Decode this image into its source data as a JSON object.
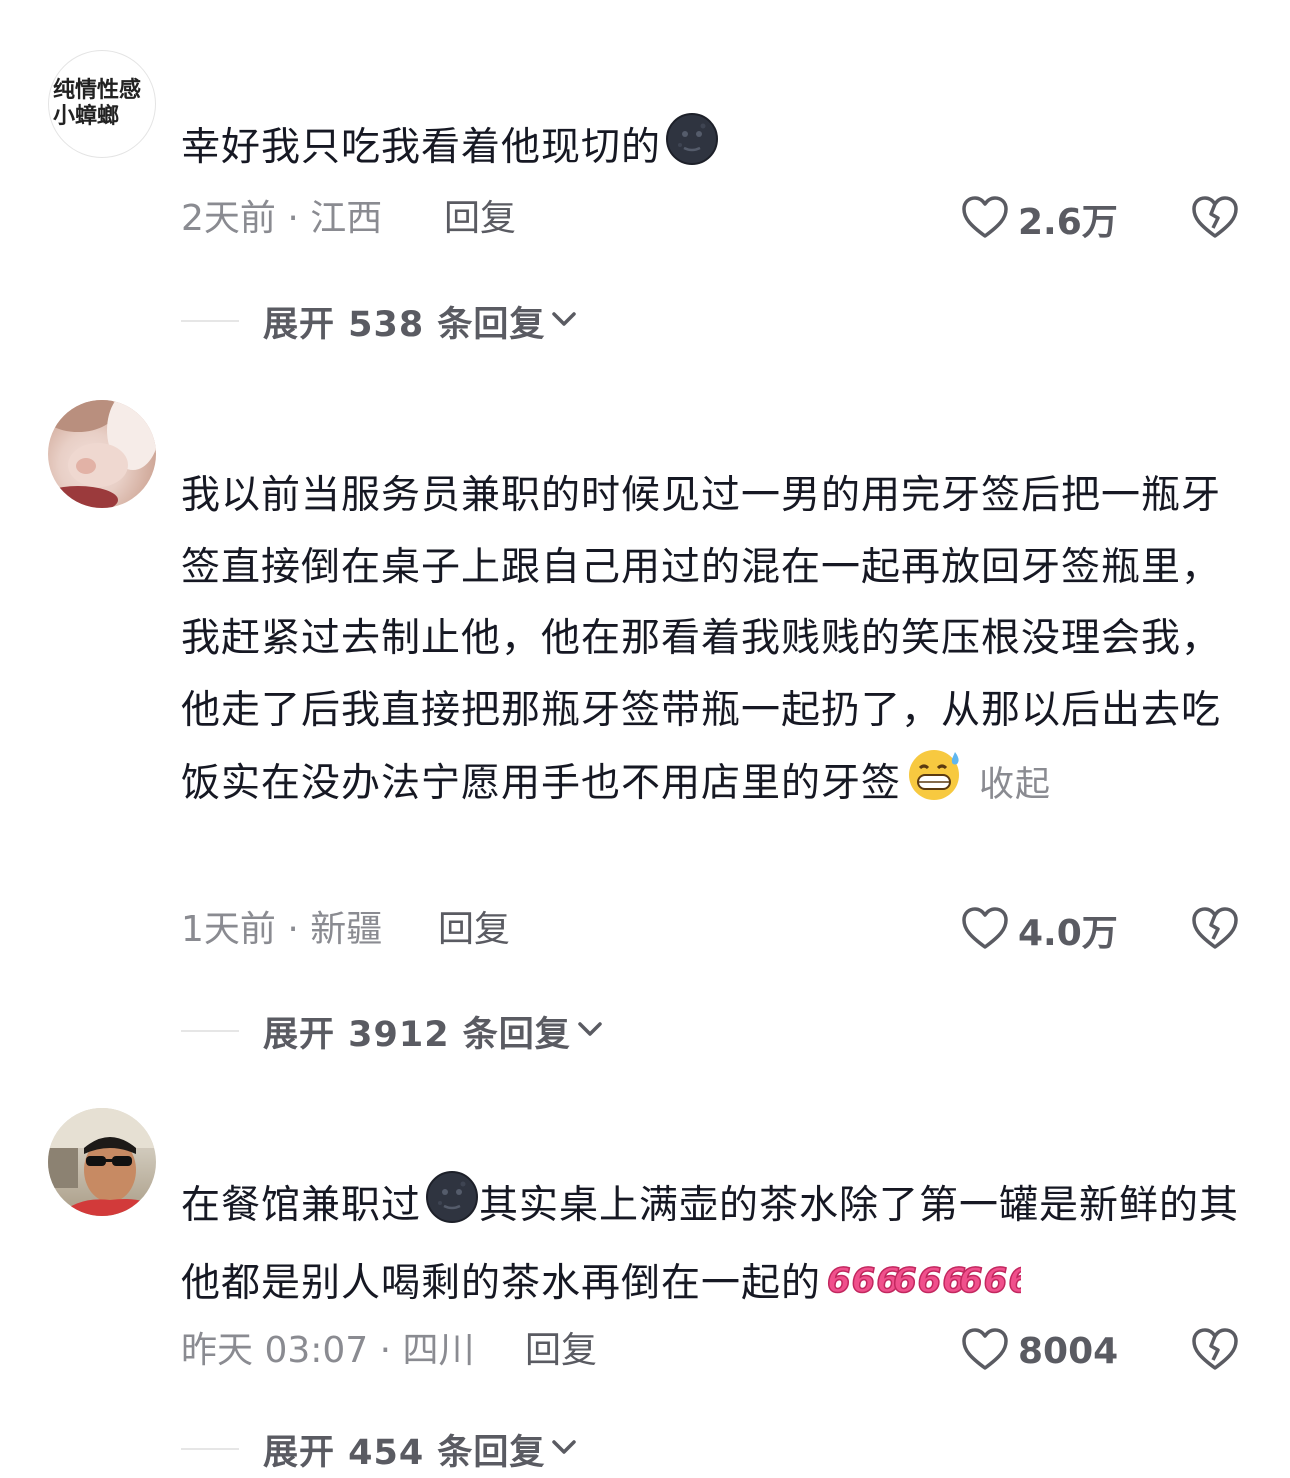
{
  "comments": [
    {
      "avatar_text_line1": "纯情性感",
      "avatar_text_line2": "小蟑螂",
      "text": "幸好我只吃我看着他现切的",
      "emoji": "new-moon-face",
      "time_location": "2天前 · 江西",
      "reply_label": "回复",
      "likes": "2.6万",
      "expand_label": "展开 538 条回复"
    },
    {
      "text": "我以前当服务员兼职的时候见过一男的用完牙签后把一瓶牙签直接倒在桌子上跟自己用过的混在一起再放回牙签瓶里，我赶紧过去制止他，他在那看着我贱贱的笑压根没理会我，他走了后我直接把那瓶牙签带瓶一起扔了，从那以后出去吃饭实在没办法宁愿用手也不用店里的牙签",
      "emoji": "grinning-sweat-face",
      "collapse_label": "收起",
      "time_location": "1天前 · 新疆",
      "reply_label": "回复",
      "likes": "4.0万",
      "expand_label": "展开 3912 条回复"
    },
    {
      "text_part1": "在餐馆兼职过",
      "text_part2": "其实桌上满壶的茶水除了第一罐是新鲜的其他都是别人喝剩的茶水再倒在一起的",
      "emoji": "new-moon-face",
      "sticker": "666",
      "time_location": "昨天 03:07 · 四川",
      "reply_label": "回复",
      "likes": "8004",
      "expand_label": "展开 454 条回复"
    }
  ],
  "colors": {
    "text": "#161823",
    "secondary": "#8a8b91",
    "action": "#5a5b62",
    "sticker": "#f0508c"
  }
}
